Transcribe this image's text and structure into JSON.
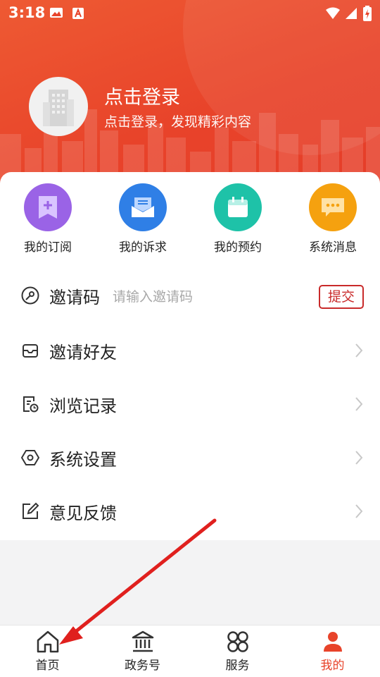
{
  "status_bar": {
    "time": "3:18"
  },
  "header": {
    "login_title": "点击登录",
    "login_subtitle": "点击登录，发现精彩内容"
  },
  "quick_actions": [
    {
      "label": "我的订阅",
      "icon": "bookmark-plus-icon",
      "color": "#9a63e6"
    },
    {
      "label": "我的诉求",
      "icon": "mail-tray-icon",
      "color": "#2f7fe6"
    },
    {
      "label": "我的预约",
      "icon": "calendar-icon",
      "color": "#1ec2a8"
    },
    {
      "label": "系统消息",
      "icon": "message-bubble-icon",
      "color": "#f5a10f"
    }
  ],
  "menu": {
    "invite_code": {
      "label": "邀请码",
      "placeholder": "请输入邀请码",
      "submit": "提交"
    },
    "items": [
      {
        "label": "邀请好友",
        "icon": "inbox-icon"
      },
      {
        "label": "浏览记录",
        "icon": "history-doc-icon"
      },
      {
        "label": "系统设置",
        "icon": "settings-hexagon-icon"
      },
      {
        "label": "意见反馈",
        "icon": "edit-icon"
      }
    ]
  },
  "bottom_nav": [
    {
      "label": "首页",
      "icon": "home-icon",
      "active": false
    },
    {
      "label": "政务号",
      "icon": "government-building-icon",
      "active": false
    },
    {
      "label": "服务",
      "icon": "services-grid-icon",
      "active": false
    },
    {
      "label": "我的",
      "icon": "person-icon",
      "active": true
    }
  ],
  "colors": {
    "accent": "#e8432a",
    "submit_border": "#c92a2a",
    "annotation_arrow": "#e0201e"
  }
}
